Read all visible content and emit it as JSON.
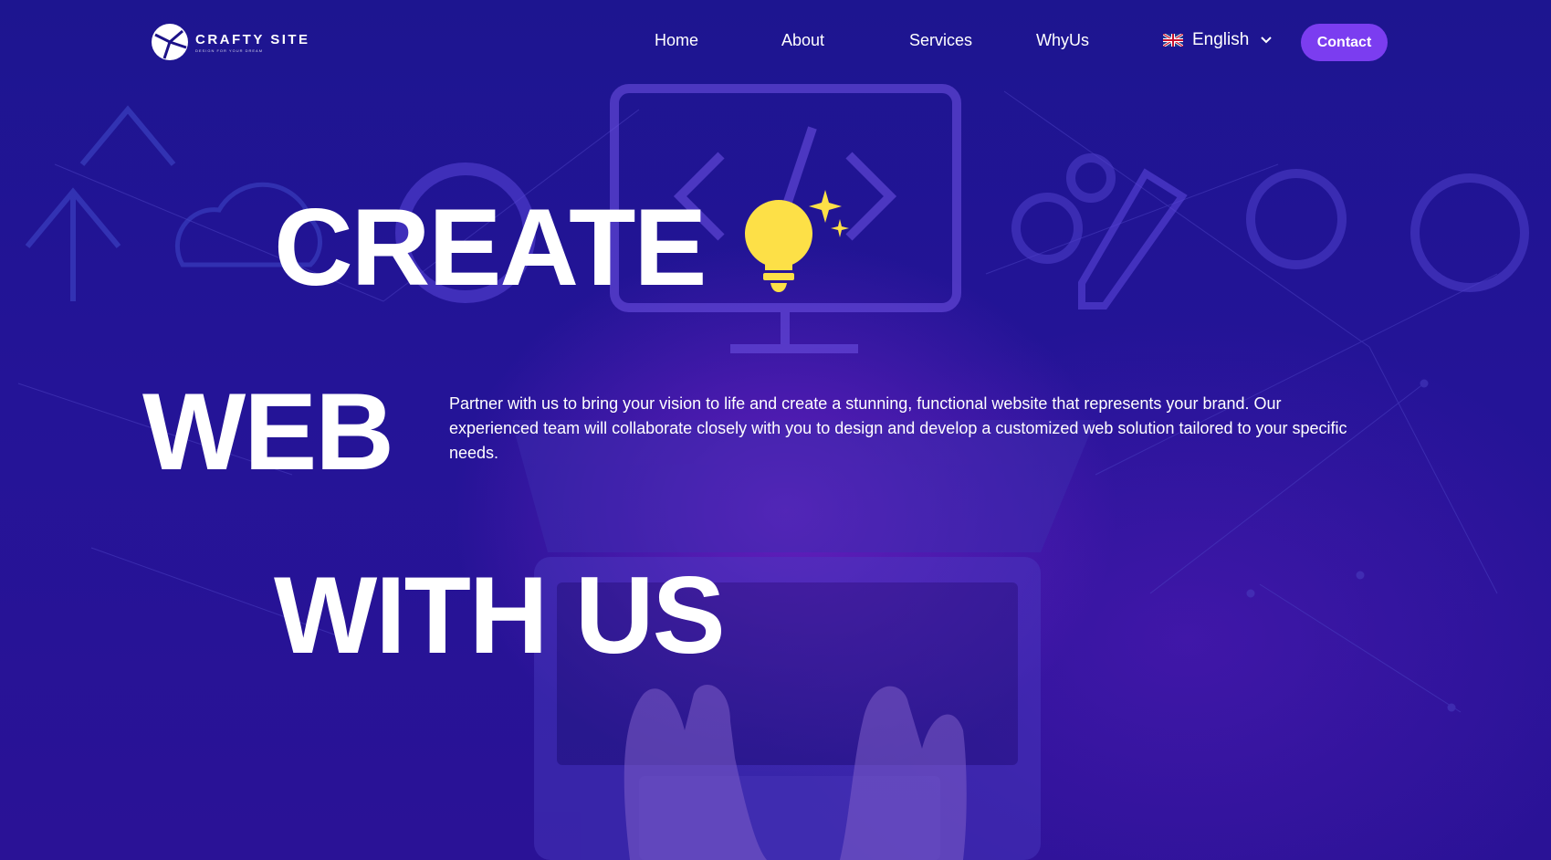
{
  "brand": {
    "name": "CRAFTY SITE",
    "tagline": "DESIGN FOR YOUR DREAM"
  },
  "nav": {
    "items": [
      {
        "label": "Home"
      },
      {
        "label": "About"
      },
      {
        "label": "Services"
      },
      {
        "label": "WhyUs"
      }
    ],
    "language": {
      "label": "English",
      "flag": "uk-flag-icon"
    },
    "contact_label": "Contact"
  },
  "hero": {
    "line1": "CREATE",
    "line2": "WEB",
    "line3": "WITH US",
    "description": "Partner with us to bring your vision to life and create a stunning, functional website that represents your brand. Our experienced team will collaborate closely with you to design and develop a customized web solution tailored to your specific needs."
  },
  "colors": {
    "accent": "#7b3df0",
    "background": "#1c1288",
    "bulb": "#fde047"
  }
}
